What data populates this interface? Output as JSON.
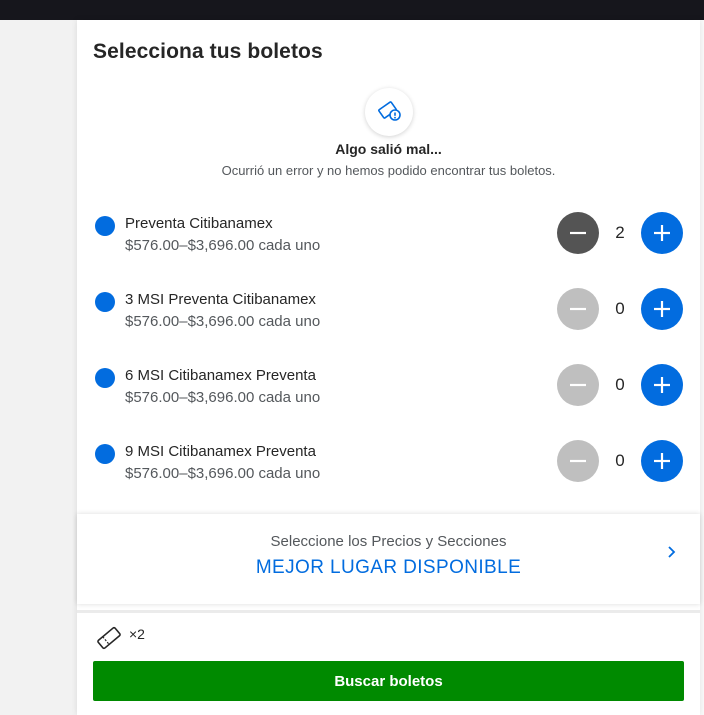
{
  "panel": {
    "title": "Selecciona tus boletos"
  },
  "error": {
    "icon": "ticket-error-icon",
    "title": "Algo salió mal...",
    "message": "Ocurrió un error y no hemos podido encontrar tus boletos."
  },
  "tickets": [
    {
      "name": "Preventa Citibanamex",
      "price": "$576.00–$3,696.00 cada uno",
      "qty": "2",
      "minus_enabled": true
    },
    {
      "name": "3 MSI Preventa Citibanamex",
      "price": "$576.00–$3,696.00 cada uno",
      "qty": "0",
      "minus_enabled": false
    },
    {
      "name": "6 MSI Citibanamex Preventa",
      "price": "$576.00–$3,696.00 cada uno",
      "qty": "0",
      "minus_enabled": false
    },
    {
      "name": "9 MSI Citibanamex Preventa",
      "price": "$576.00–$3,696.00 cada uno",
      "qty": "0",
      "minus_enabled": false
    }
  ],
  "best_available": {
    "subtitle": "Seleccione los Precios y Secciones",
    "label": "MEJOR LUGAR DISPONIBLE"
  },
  "summary": {
    "count": "×2"
  },
  "search_button": "Buscar boletos",
  "colors": {
    "accent": "#026cdf",
    "minus_active": "#545454",
    "minus_disabled": "#bfbfbf",
    "search": "#008a00"
  }
}
